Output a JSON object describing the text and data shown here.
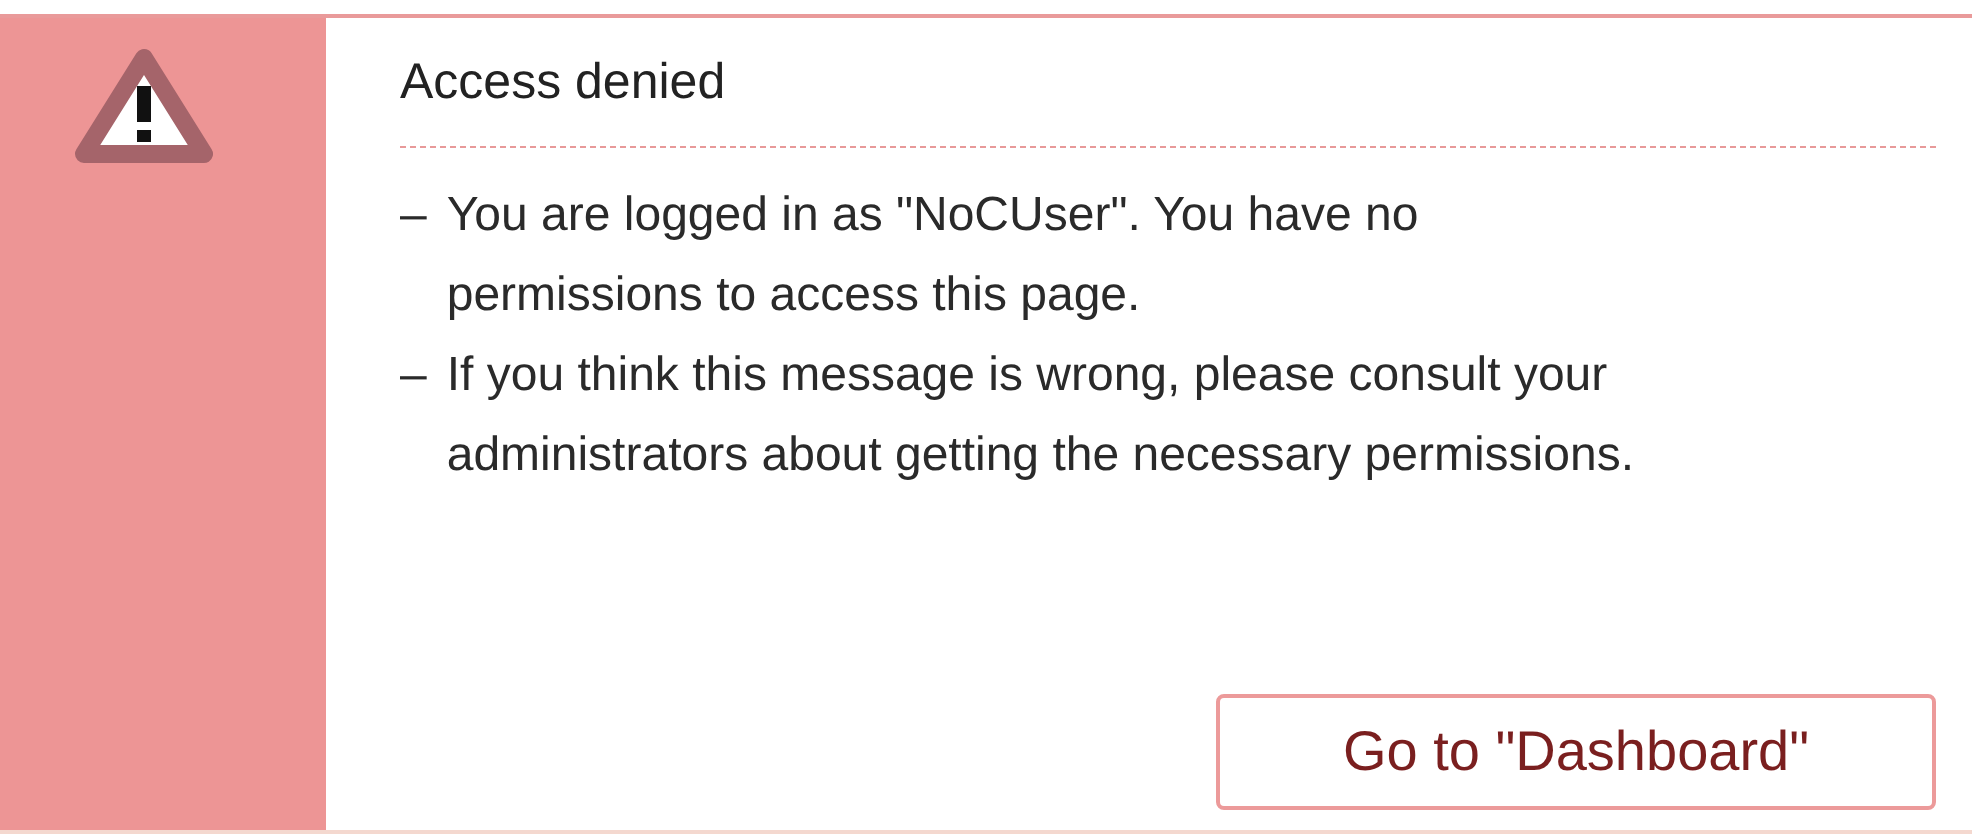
{
  "alert": {
    "title": "Access denied",
    "messages": [
      {
        "marker": "–",
        "text": "You are logged in as \"NoCUser\". You have no permissions to access this page."
      },
      {
        "marker": "–",
        "text": "If you think this message is wrong, please consult your administrators about getting the necessary permissions."
      }
    ],
    "button": "Go to \"Dashboard\""
  }
}
